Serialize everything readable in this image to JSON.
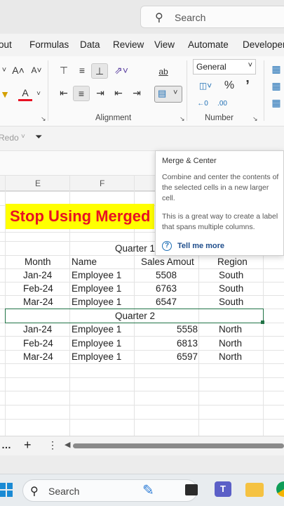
{
  "titlebar": {
    "search_placeholder": "Search"
  },
  "menu": {
    "tabs": [
      "out",
      "Formulas",
      "Data",
      "Review",
      "View",
      "Automate",
      "Developer"
    ]
  },
  "ribbon": {
    "alignment_label": "Alignment",
    "number_label": "Number",
    "number_format": "General",
    "percent": "%",
    "comma": "’",
    "font_grow": "A˄",
    "font_shrink": "A˅",
    "font_color": "A",
    "wrap_text": "ab",
    "dec_increase": "←.0\n.00",
    "dec_decrease": ".00\n→.0"
  },
  "qat": {
    "redo_label": "Redo"
  },
  "grid": {
    "col_headers": [
      "E",
      "F"
    ],
    "banner_text": "Stop Using Merged",
    "quarter1_label": "Quarter 1",
    "quarter2_label": "Quarter 2",
    "headers": {
      "month": "Month",
      "name": "Name",
      "sales": "Sales Amout",
      "region": "Region"
    },
    "q1_rows": [
      {
        "month": "Jan-24",
        "name": "Employee 1",
        "sales": "5508",
        "region": "South"
      },
      {
        "month": "Feb-24",
        "name": "Employee 1",
        "sales": "6763",
        "region": "South"
      },
      {
        "month": "Mar-24",
        "name": "Employee 1",
        "sales": "6547",
        "region": "South"
      }
    ],
    "q2_rows": [
      {
        "month": "Jan-24",
        "name": "Employee 1",
        "sales": "5558",
        "region": "North"
      },
      {
        "month": "Feb-24",
        "name": "Employee 1",
        "sales": "6813",
        "region": "North"
      },
      {
        "month": "Mar-24",
        "name": "Employee 1",
        "sales": "6597",
        "region": "North"
      }
    ]
  },
  "tooltip": {
    "title": "Merge & Center",
    "body1": "Combine and center the contents of the selected cells in a new larger cell.",
    "body2": "This is a great way to create a label that spans multiple columns.",
    "help": "Tell me more"
  },
  "sheetbar": {
    "more": "…",
    "add": "+",
    "options": "⋮"
  },
  "taskbar": {
    "search_placeholder": "Search"
  },
  "colors": {
    "banner_bg": "#ffff00",
    "banner_text": "#e81123",
    "selection": "#217346",
    "help_link": "#1f4e8c"
  }
}
